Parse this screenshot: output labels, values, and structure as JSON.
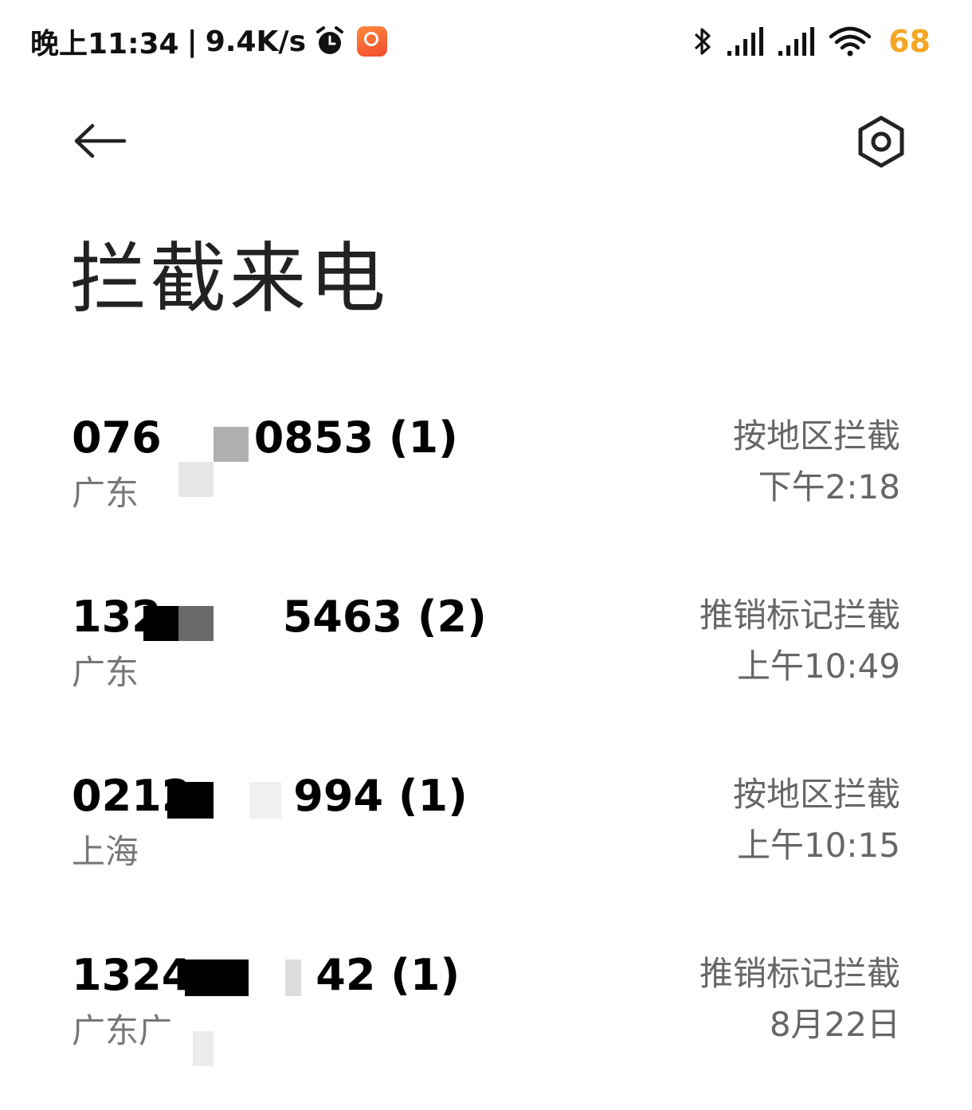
{
  "status_bar": {
    "time": "晚上11:34",
    "separator": "|",
    "net_speed": "9.4K/s",
    "battery": "68",
    "icons": [
      "alarm-icon",
      "app-notification-icon",
      "bluetooth-icon",
      "signal-icon",
      "signal-icon",
      "wifi-icon"
    ]
  },
  "toolbar": {
    "back_icon": "arrow-left-icon",
    "settings_icon": "hexagon-settings-icon"
  },
  "page": {
    "title": "拦截来电"
  },
  "calls": [
    {
      "number_prefix": "076",
      "number_suffix": "0853 (1)",
      "region": "广东",
      "reason": "按地区拦截",
      "time": "下午2:18"
    },
    {
      "number_prefix": "132",
      "number_suffix": "5463 (2)",
      "region": "广东",
      "reason": "推销标记拦截",
      "time": "上午10:49"
    },
    {
      "number_prefix": "0212",
      "number_suffix": "994 (1)",
      "region": "上海",
      "reason": "按地区拦截",
      "time": "上午10:15"
    },
    {
      "number_prefix": "1324",
      "number_suffix": "42 (1)",
      "region": "广东广",
      "reason": "推销标记拦截",
      "time": "8月22日"
    }
  ],
  "colors": {
    "accent_battery": "#f5a623",
    "title_text": "#222222",
    "secondary_text": "#666666"
  }
}
